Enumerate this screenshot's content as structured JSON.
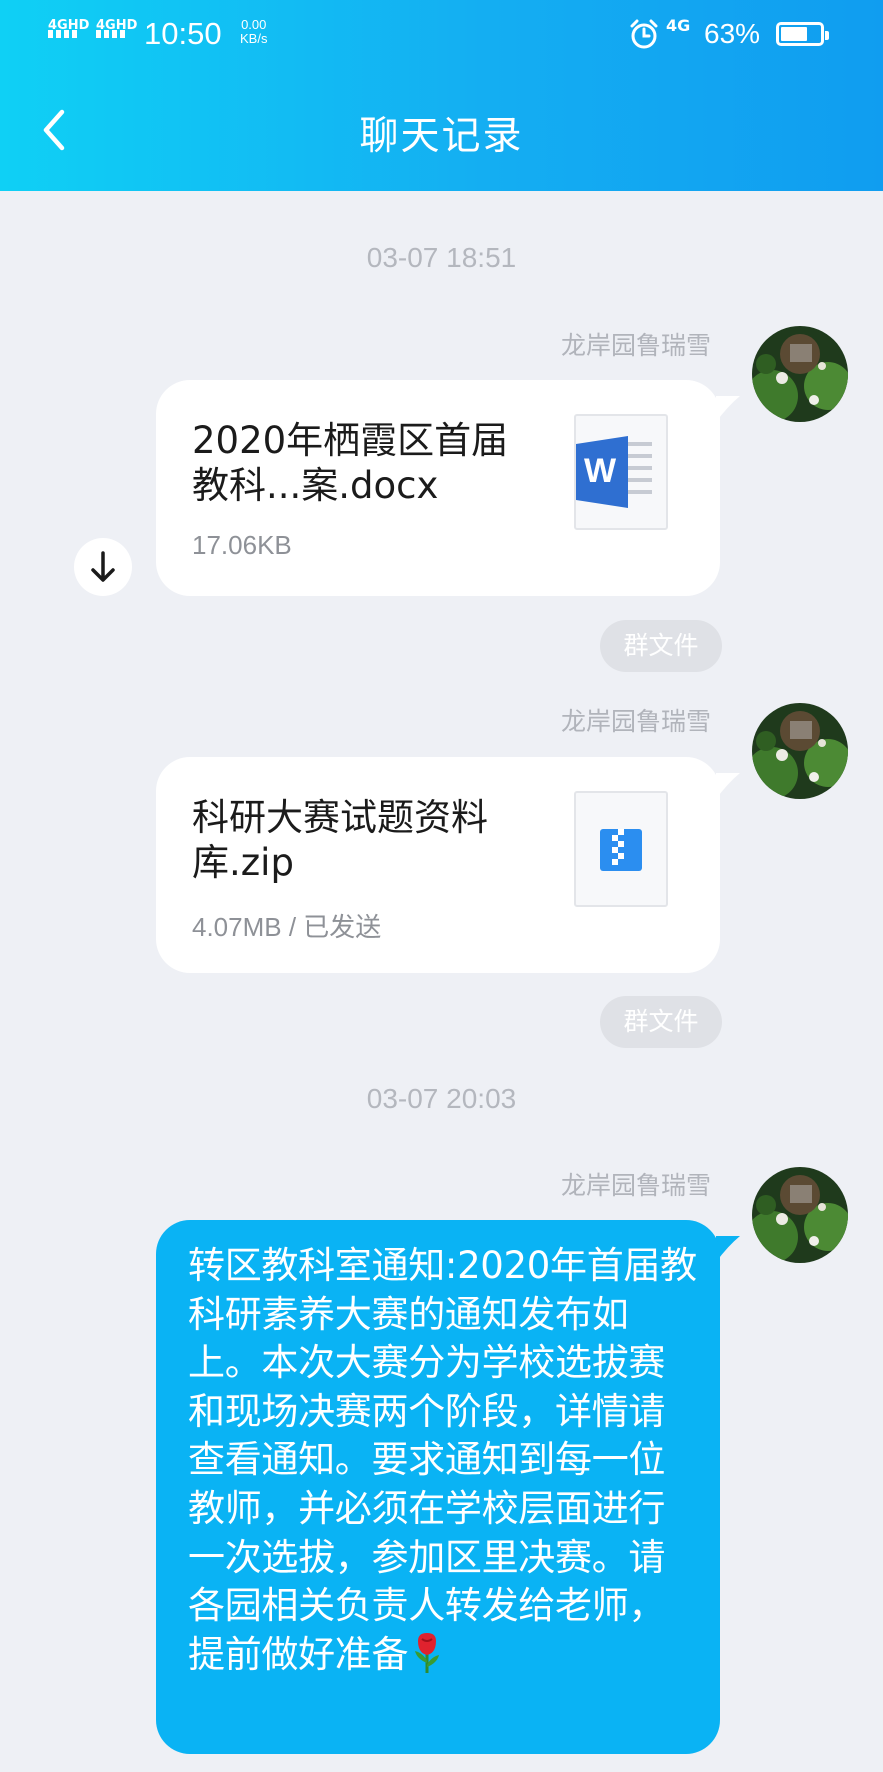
{
  "status_bar": {
    "signal_1": "4GHD",
    "signal_2": "4GHD",
    "time": "10:50",
    "speed_value": "0.00",
    "speed_unit": "KB/s",
    "network": "4G",
    "battery": "63%"
  },
  "header": {
    "title": "聊天记录"
  },
  "chat": {
    "timestamps": [
      "03-07 18:51",
      "03-07 20:03"
    ],
    "messages": [
      {
        "sender": "龙岸园鲁瑞雪",
        "type": "file",
        "file_name": "2020年栖霞区首届教科...案.docx",
        "file_meta": "17.06KB",
        "file_icon": "word-icon",
        "tag": "群文件"
      },
      {
        "sender": "龙岸园鲁瑞雪",
        "type": "file",
        "file_name": "科研大赛试题资料库.zip",
        "file_meta": "4.07MB / 已发送",
        "file_icon": "zip-icon",
        "tag": "群文件"
      },
      {
        "sender": "龙岸园鲁瑞雪",
        "type": "text",
        "text": "转区教科室通知:2020年首届教科研素养大赛的通知发布如上。本次大赛分为学校选拔赛和现场决赛两个阶段，详情请查看通知。要求通知到每一位教师，并必须在学校层面进行一次选拔，参加区里决赛。请各园相关负责人转发给老师，提前做好准备",
        "emoji": "rose-emoji"
      }
    ]
  },
  "colors": {
    "header_start": "#0fd0f5",
    "header_end": "#109df0",
    "background": "#eef0f5",
    "outgoing_bubble": "#0ab3f4",
    "word_blue": "#2f6fd1",
    "zip_blue": "#2b8ef0"
  }
}
